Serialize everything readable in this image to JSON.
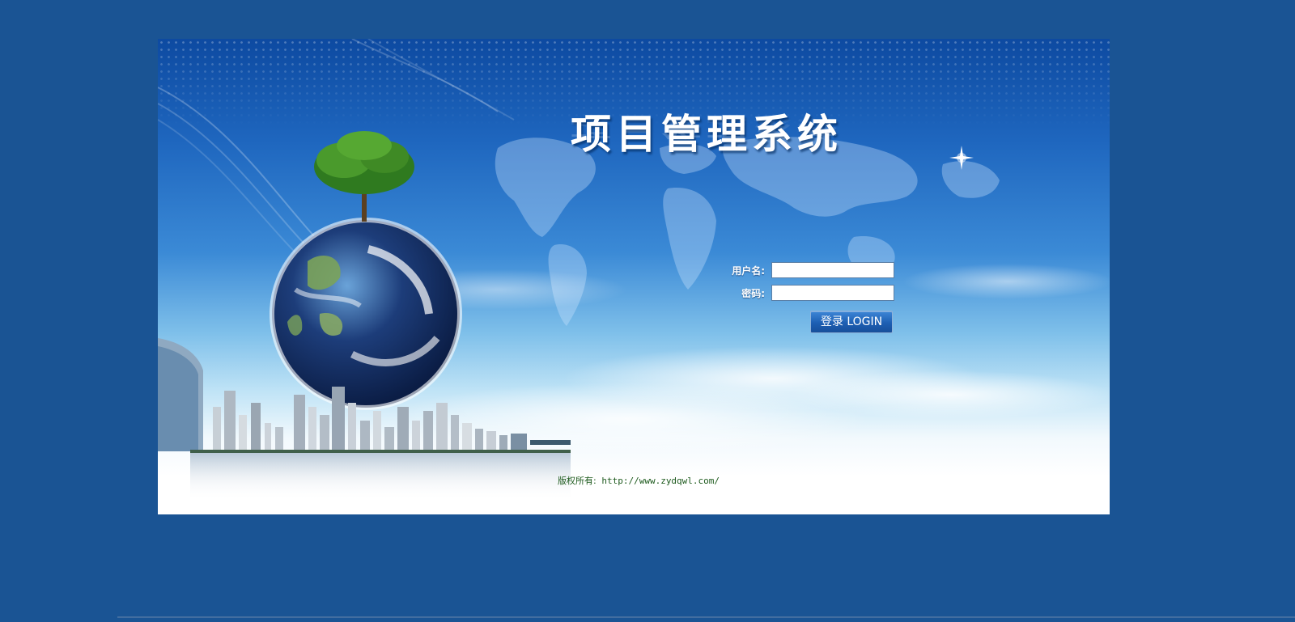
{
  "app": {
    "title": "项目管理系统",
    "title_reflection": "项目管理系统"
  },
  "login": {
    "username_label": "用户名:",
    "username_value": "",
    "password_label": "密码:",
    "password_value": "",
    "login_button": "登录 LOGIN"
  },
  "footer": {
    "copyright_label": "版权所有:",
    "copyright_url": "http://www.zydqwl.com/"
  },
  "colors": {
    "page_background": "#1a5494",
    "button": "#1d5fb3",
    "copyright_text": "#1d5a1d"
  },
  "icons": {
    "globe": "earth-globe-icon",
    "tree": "tree-icon",
    "star": "sparkle-star-icon"
  }
}
